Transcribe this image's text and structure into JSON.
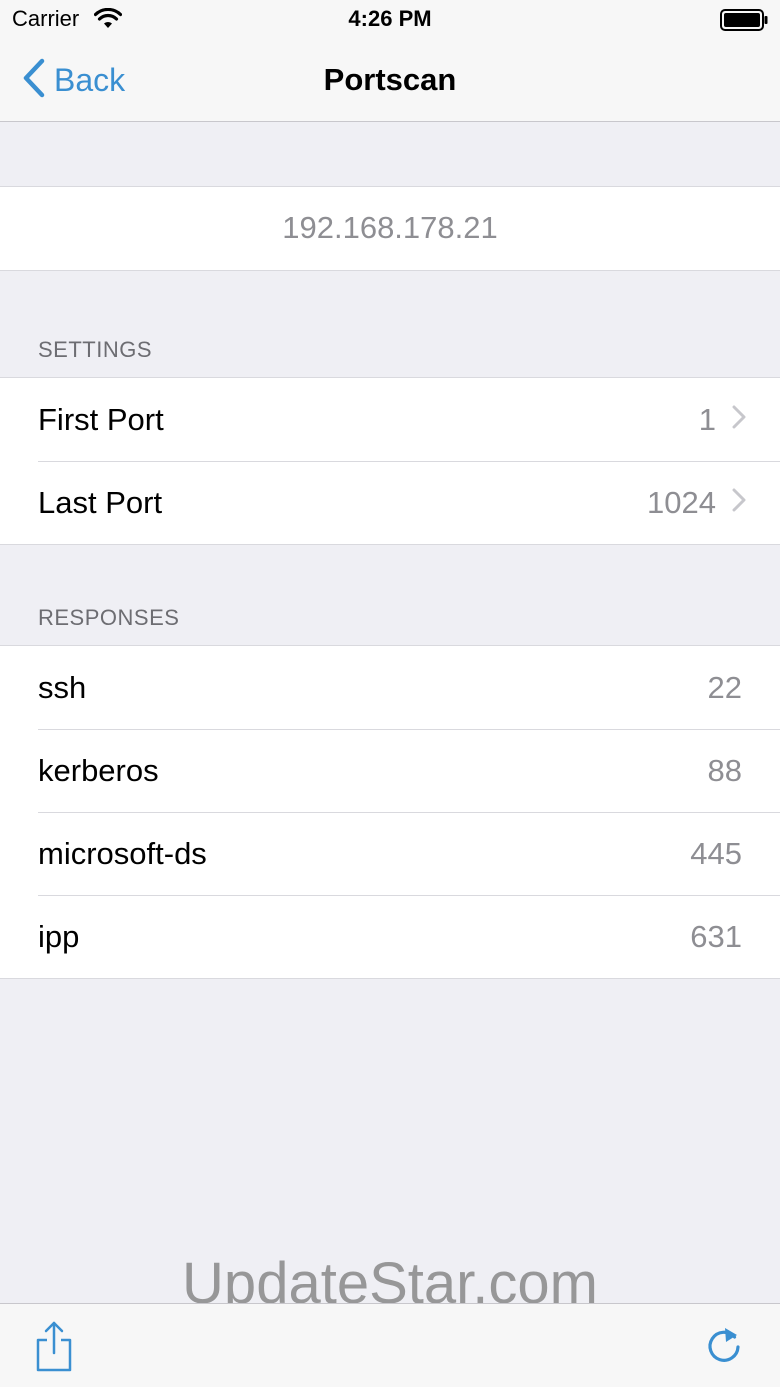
{
  "status_bar": {
    "carrier": "Carrier",
    "time": "4:26 PM"
  },
  "nav": {
    "back_label": "Back",
    "title": "Portscan"
  },
  "host": {
    "address": "192.168.178.21"
  },
  "settings": {
    "header": "SETTINGS",
    "rows": [
      {
        "label": "First Port",
        "value": "1"
      },
      {
        "label": "Last Port",
        "value": "1024"
      }
    ]
  },
  "responses": {
    "header": "RESPONSES",
    "rows": [
      {
        "label": "ssh",
        "value": "22"
      },
      {
        "label": "kerberos",
        "value": "88"
      },
      {
        "label": "microsoft-ds",
        "value": "445"
      },
      {
        "label": "ipp",
        "value": "631"
      }
    ]
  },
  "watermark": "UpdateStar.com",
  "colors": {
    "accent": "#3a8fd1",
    "background": "#efeff4",
    "secondary_text": "#8e8e93"
  },
  "icons": [
    "wifi-icon",
    "battery-icon",
    "back-chevron-icon",
    "chevron-right-icon",
    "share-icon",
    "refresh-icon"
  ]
}
